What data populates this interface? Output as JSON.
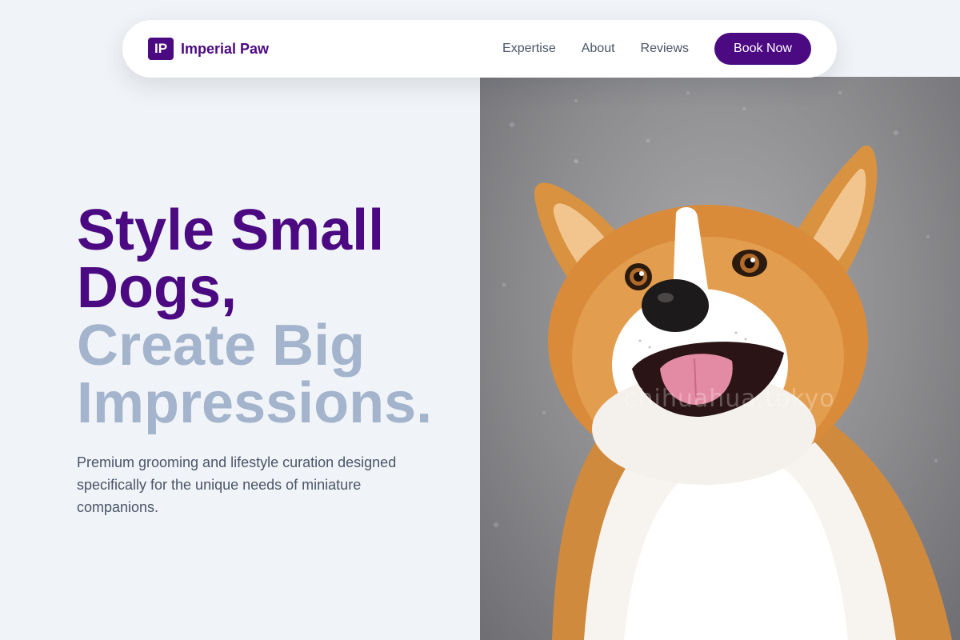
{
  "nav": {
    "logo_mark": "IP",
    "brand": "Imperial Paw",
    "links": [
      "Expertise",
      "About",
      "Reviews"
    ],
    "cta": "Book Now"
  },
  "hero": {
    "headline_line1": "Style Small",
    "headline_line2": "Dogs,",
    "headline_line3": "Create Big",
    "headline_line4": "Impressions.",
    "subtext": "Premium grooming and lifestyle curation designed specifically for the unique needs of miniature companions.",
    "image_watermark": "chihuahua.tokyo"
  },
  "colors": {
    "brand_purple": "#4b0a82",
    "headline_muted": "#a3b4cc",
    "background": "#f0f3f7",
    "body_text": "#4a5568"
  }
}
